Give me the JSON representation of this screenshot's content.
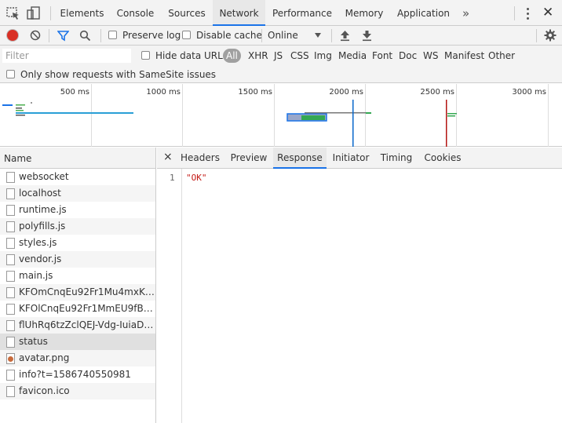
{
  "main_tabs": [
    "Elements",
    "Console",
    "Sources",
    "Network",
    "Performance",
    "Memory",
    "Application"
  ],
  "active_main_tab": "Network",
  "overflow_label": "»",
  "close_label": "✕",
  "toolbar": {
    "preserve_log_label": "Preserve log",
    "preserve_log_checked": false,
    "disable_cache_label": "Disable cache",
    "disable_cache_checked": false,
    "throttling_value": "Online"
  },
  "filter": {
    "placeholder": "Filter",
    "hide_data_urls_label": "Hide data URLs",
    "types": [
      "All",
      "XHR",
      "JS",
      "CSS",
      "Img",
      "Media",
      "Font",
      "Doc",
      "WS",
      "Manifest",
      "Other"
    ],
    "active_type": "All",
    "samesite_label": "Only show requests with SameSite issues"
  },
  "overview": {
    "ticks": [
      "500 ms",
      "1000 ms",
      "1500 ms",
      "2000 ms",
      "2500 ms",
      "3000 ms"
    ]
  },
  "request_list": {
    "header": "Name",
    "rows": [
      {
        "name": "websocket",
        "icon": "file-icon"
      },
      {
        "name": "localhost",
        "icon": "file-icon"
      },
      {
        "name": "runtime.js",
        "icon": "file-icon"
      },
      {
        "name": "polyfills.js",
        "icon": "file-icon"
      },
      {
        "name": "styles.js",
        "icon": "file-icon"
      },
      {
        "name": "vendor.js",
        "icon": "file-icon"
      },
      {
        "name": "main.js",
        "icon": "file-icon"
      },
      {
        "name": "KFOmCnqEu92Fr1Mu4mxK.wo...",
        "icon": "file-icon"
      },
      {
        "name": "KFOlCnqEu92Fr1MmEU9fBBc4...",
        "icon": "file-icon"
      },
      {
        "name": "flUhRq6tzZclQEJ-Vdg-IuiaDsN...",
        "icon": "file-icon"
      },
      {
        "name": "status",
        "icon": "file-icon"
      },
      {
        "name": "avatar.png",
        "icon": "image-icon"
      },
      {
        "name": "info?t=1586740550981",
        "icon": "file-icon"
      },
      {
        "name": "favicon.ico",
        "icon": "file-icon"
      }
    ],
    "selected_index": 10
  },
  "detail": {
    "close_label": "×",
    "tabs": [
      "Headers",
      "Preview",
      "Response",
      "Initiator",
      "Timing",
      "Cookies"
    ],
    "active_tab": "Response",
    "line_number": "1",
    "response_body": "\"OK\""
  },
  "colors": {
    "accent": "#1a73e8",
    "record": "#d93025",
    "filter_icon": "#1a73e8",
    "dom_content_loaded": "#0867cb",
    "load_event": "#b31412",
    "response_text": "#c41a16"
  }
}
